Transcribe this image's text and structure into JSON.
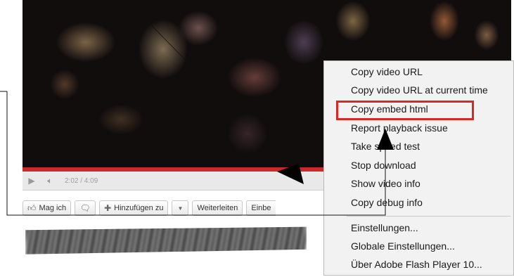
{
  "player": {
    "time": "2:02 / 4:09",
    "progress_fraction": 0.49
  },
  "actions": {
    "like": "Mag ich",
    "add": "Hinzufügen zu",
    "share": "Weiterleiten",
    "embed": "Einbe"
  },
  "context_menu": {
    "items": [
      "Copy video URL",
      "Copy video URL at current time",
      "Copy embed html",
      "Report playback issue",
      "Take speed test",
      "Stop download",
      "Show video info",
      "Copy debug info"
    ],
    "settings_items": [
      "Einstellungen...",
      "Globale Einstellungen...",
      "Über Adobe Flash Player 10..."
    ],
    "highlighted_item": "Copy embed html",
    "highlight_color": "#d42a2a"
  },
  "colors": {
    "progress": "#cc2a2a"
  }
}
